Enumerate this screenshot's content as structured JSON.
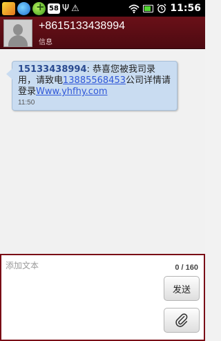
{
  "status_bar": {
    "time": "11:56",
    "badge_text": "58",
    "icons": [
      "app-icon",
      "browser-icon",
      "app-plus-icon",
      "usb-icon",
      "warning-icon",
      "wifi-icon",
      "battery-icon",
      "alarm-icon"
    ],
    "battery_fill_color": "#53d633"
  },
  "header": {
    "number": "+8615133438994",
    "subtitle": "信息"
  },
  "message": {
    "sender": "15133438994",
    "separator": ": ",
    "text_1": "恭喜您被我司录用，请致电",
    "phone_link": "13885568453",
    "text_2": "公司详情请登录",
    "url_link": "Www.yhfhy.com",
    "time": "11:50"
  },
  "compose": {
    "placeholder": "添加文本",
    "counter": "0 / 160",
    "send_label": "发送"
  },
  "colors": {
    "header_bg": "#5b0d14",
    "bubble_bg": "#c9dcf1",
    "link": "#2f57d8",
    "compose_border": "#7a0d16"
  }
}
